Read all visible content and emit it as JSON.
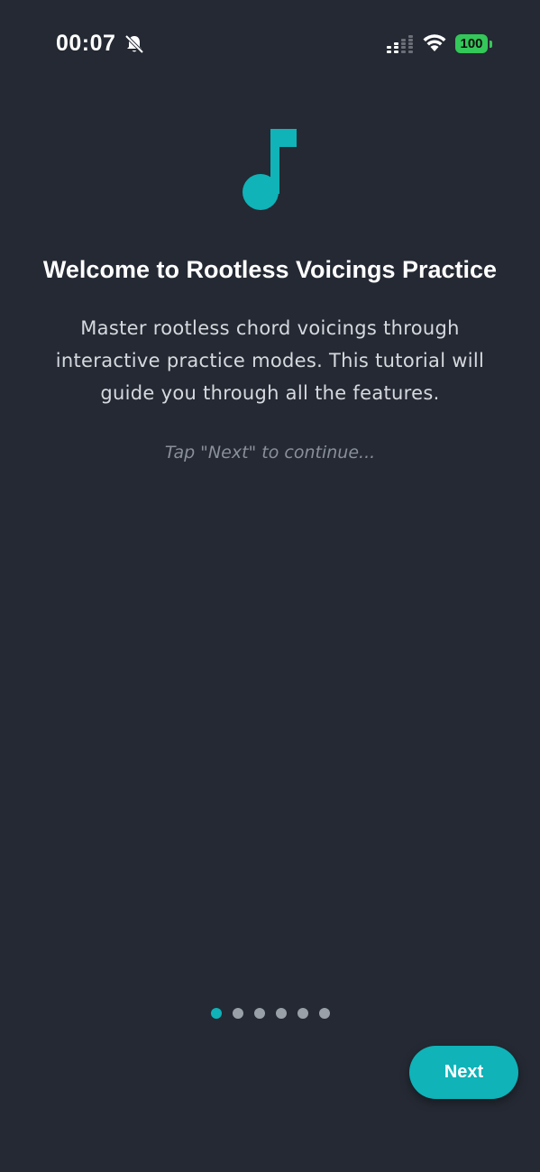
{
  "status_bar": {
    "time": "00:07",
    "battery": "100",
    "icons": [
      "bell-slash-icon",
      "cellular-signal-icon",
      "wifi-icon",
      "battery-icon"
    ]
  },
  "welcome": {
    "title": "Welcome to Rootless Voicings Practice",
    "subtitle": "Master rootless chord voicings through interactive practice modes. This tutorial will guide you through all the features.",
    "hint": "Tap \"Next\" to continue...",
    "icon": "music-note-icon"
  },
  "pagination": {
    "total": 6,
    "current": 1
  },
  "actions": {
    "next_label": "Next"
  },
  "colors": {
    "background": "#242933",
    "accent": "#0fb3b8",
    "battery": "#34c759"
  }
}
